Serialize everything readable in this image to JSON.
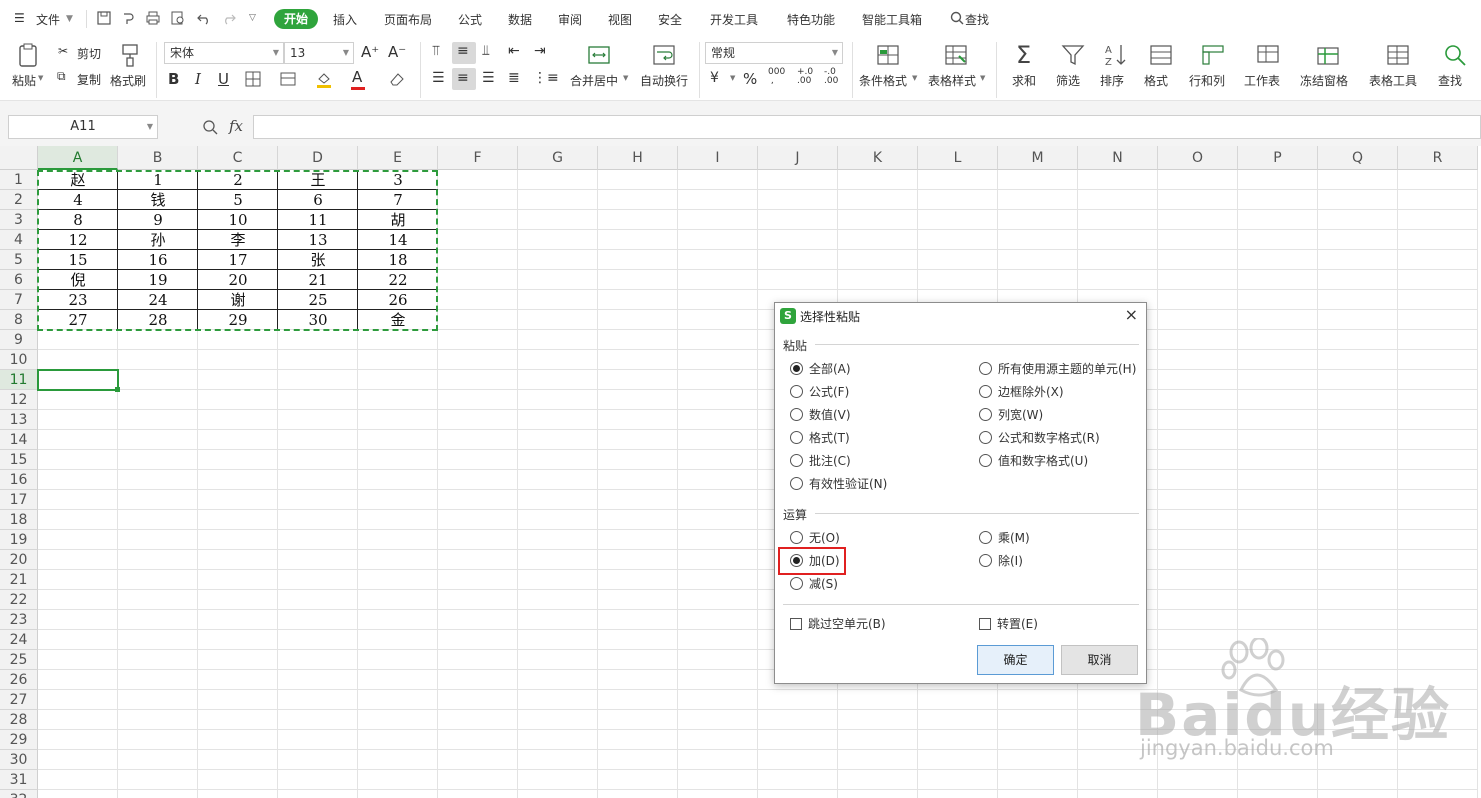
{
  "menubar": {
    "file_label": "文件",
    "tabs": [
      "开始",
      "插入",
      "页面布局",
      "公式",
      "数据",
      "审阅",
      "视图",
      "安全",
      "开发工具",
      "特色功能",
      "智能工具箱"
    ],
    "search_label": "查找",
    "active_color": "#2fa43c"
  },
  "ribbon": {
    "paste": "粘贴",
    "cut": "剪切",
    "copy": "复制",
    "format_painter": "格式刷",
    "font_name": "宋体",
    "font_size": "13",
    "number_format": "常规",
    "merge_center": "合并居中",
    "wrap_text": "自动换行",
    "conditional_format": "条件格式",
    "table_style": "表格样式",
    "sum": "求和",
    "filter": "筛选",
    "sort": "排序",
    "format": "格式",
    "row_col": "行和列",
    "worksheet": "工作表",
    "freeze": "冻结窗格",
    "table_tools": "表格工具",
    "find": "查找",
    "percent": "%",
    "bold": "B",
    "italic": "I",
    "underline": "U",
    "font_color": "A"
  },
  "formula_bar": {
    "name_box": "A11",
    "fx": "fx",
    "value": ""
  },
  "grid": {
    "columns": [
      "A",
      "B",
      "C",
      "D",
      "E",
      "F",
      "G",
      "H",
      "I",
      "J",
      "K",
      "L",
      "M",
      "N",
      "O",
      "P",
      "Q",
      "R"
    ],
    "rows": [
      "1",
      "2",
      "3",
      "4",
      "5",
      "6",
      "7",
      "8",
      "9",
      "10",
      "11",
      "12",
      "13",
      "14",
      "15",
      "16",
      "17",
      "18",
      "19",
      "20",
      "21",
      "22",
      "23",
      "24",
      "25",
      "26",
      "27",
      "28",
      "29",
      "30",
      "31",
      "32"
    ],
    "data": [
      [
        "赵",
        "1",
        "2",
        "王",
        "3"
      ],
      [
        "4",
        "钱",
        "5",
        "6",
        "7"
      ],
      [
        "8",
        "9",
        "10",
        "11",
        "胡"
      ],
      [
        "12",
        "孙",
        "李",
        "13",
        "14"
      ],
      [
        "15",
        "16",
        "17",
        "张",
        "18"
      ],
      [
        "倪",
        "19",
        "20",
        "21",
        "22"
      ],
      [
        "23",
        "24",
        "谢",
        "25",
        "26"
      ],
      [
        "27",
        "28",
        "29",
        "30",
        "金"
      ]
    ],
    "active_cell": "A11"
  },
  "dialog": {
    "title": "选择性粘贴",
    "logo": "S",
    "close": "×",
    "paste_group": "粘贴",
    "paste_options_left": [
      "全部(A)",
      "公式(F)",
      "数值(V)",
      "格式(T)",
      "批注(C)",
      "有效性验证(N)"
    ],
    "paste_options_right": [
      "所有使用源主题的单元(H)",
      "边框除外(X)",
      "列宽(W)",
      "公式和数字格式(R)",
      "值和数字格式(U)"
    ],
    "paste_selected": "全部(A)",
    "op_group": "运算",
    "op_options_left": [
      "无(O)",
      "加(D)",
      "减(S)"
    ],
    "op_options_right": [
      "乘(M)",
      "除(I)"
    ],
    "op_selected": "加(D)",
    "skip_blanks": "跳过空单元(B)",
    "transpose": "转置(E)",
    "ok": "确定",
    "cancel": "取消",
    "highlight_color": "#e02020"
  },
  "watermark": {
    "brand": "Baidu经验",
    "url": "jingyan.baidu.com"
  }
}
